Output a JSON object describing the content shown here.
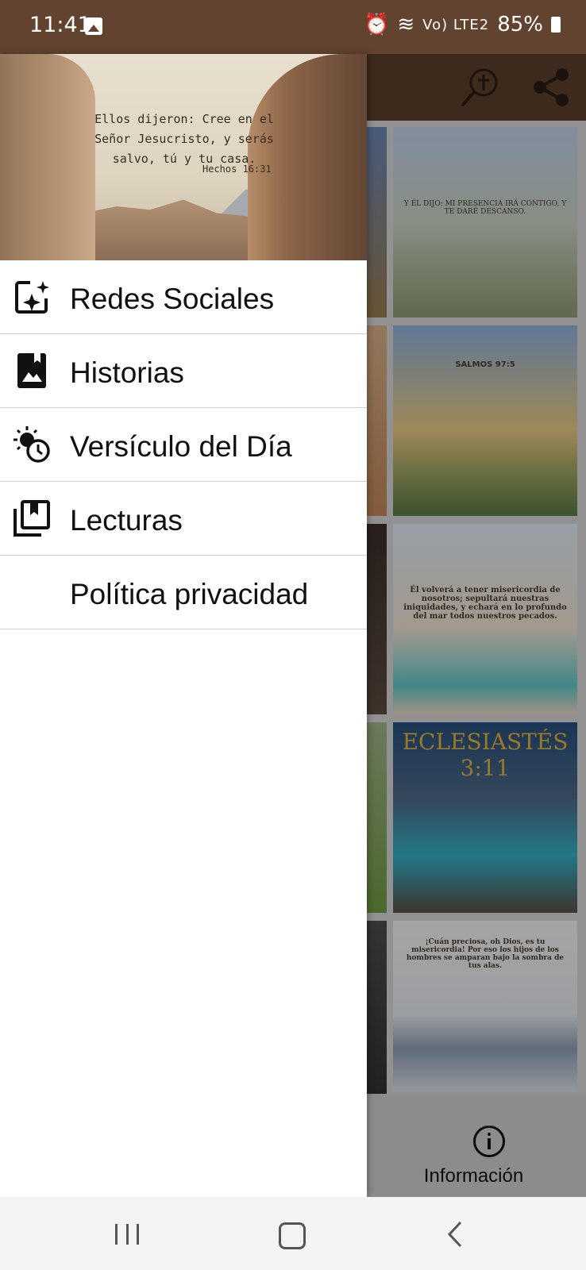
{
  "status_bar": {
    "time": "11:41",
    "signal_text": "Vo) LTE2",
    "battery": "85%"
  },
  "drawer": {
    "header": {
      "quote": "Ellos dijeron: Cree en el Señor Jesucristo, y serás salvo, tú y tu casa.",
      "reference": "Hechos 16:31"
    },
    "items": [
      {
        "label": "Redes Sociales",
        "icon": "auto-awesome-icon"
      },
      {
        "label": "Historias",
        "icon": "photo-album-icon"
      },
      {
        "label": "Versículo del Día",
        "icon": "sun-clock-icon"
      },
      {
        "label": "Lecturas",
        "icon": "library-books-icon"
      },
      {
        "label": "Política privacidad",
        "icon": ""
      }
    ]
  },
  "background": {
    "cards": [
      {
        "text": "Y ÉL DIJO: MI PRESENCIA IRÁ CONTIGO, Y TE DARÉ DESCANSO."
      },
      {
        "text": "SALMOS 97:5"
      },
      {
        "text": "Él volverá a tener misericordia de nosotros; sepultará nuestras iniquidades, y echará en lo profundo del mar todos nuestros pecados."
      },
      {
        "text": "ECLESIASTÉS 3:11"
      },
      {
        "text": "¡Cuán preciosa, oh Dios, es tu misericordia! Por eso los hijos de los hombres se amparan bajo la sombra de tus alas."
      }
    ],
    "info_label": "Información"
  },
  "colors": {
    "statusbar": "#62432f",
    "appbar": "#5a3e2c"
  }
}
